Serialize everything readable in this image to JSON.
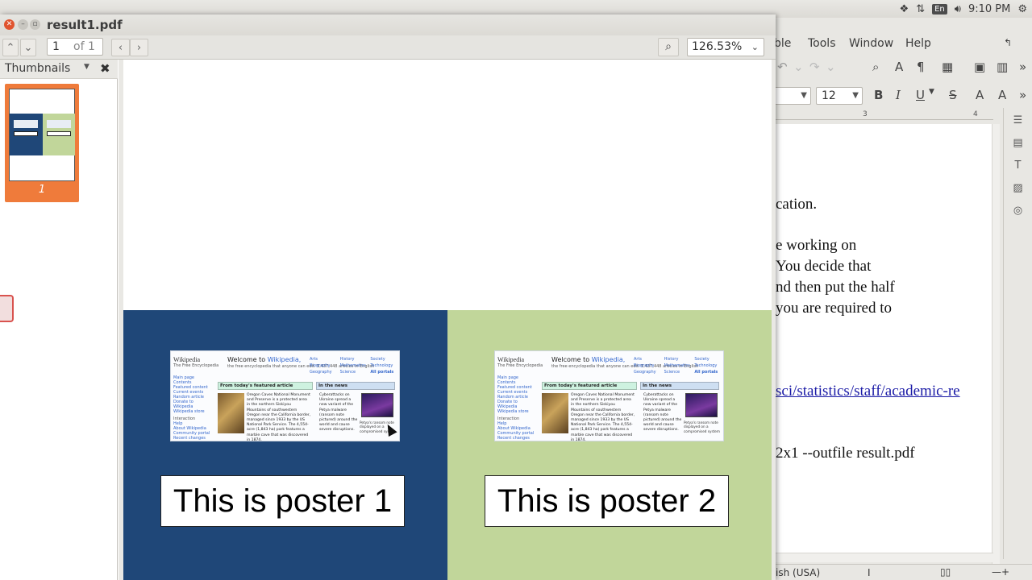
{
  "topbar": {
    "keyboard_layout": "En",
    "clock": "9:10 PM"
  },
  "writer": {
    "menu": [
      "ble",
      "Tools",
      "Window",
      "Help"
    ],
    "font_size": "12",
    "format_icons": {
      "bold": "B",
      "italic": "I",
      "underline": "U",
      "strike": "S"
    },
    "ruler_marks": [
      "3",
      "4"
    ],
    "doc_lines": [
      "cation.",
      "e working on",
      " You decide that",
      "nd then put the half",
      "you are required to"
    ],
    "doc_link": "sci/statistics/staff/academic-re",
    "doc_cmd": "2x1 --outfile result.pdf",
    "status_lang": "ish (USA)"
  },
  "viewer": {
    "title": "result1.pdf",
    "page_current": "1",
    "page_of": "of 1",
    "zoom": "126.53%",
    "sidebar_title": "Thumbnails",
    "thumb_page_label": "1"
  },
  "posters": [
    {
      "caption": "This is poster 1",
      "color": "#1f4778"
    },
    {
      "caption": "This is poster 2",
      "color": "#c1d69a"
    }
  ],
  "wiki": {
    "logo": "Wikipedia",
    "logo_sub": "The Free Encyclopedia",
    "welcome_prefix": "Welcome to ",
    "welcome_link": "Wikipedia,",
    "welcome_sub": "the free encyclopedia that anyone can edit. 5,437,448 articles in English",
    "nav": [
      "Main page",
      "Contents",
      "Featured content",
      "Current events",
      "Random article",
      "Donate to Wikipedia",
      "Wikipedia store",
      "Interaction",
      "Help",
      "About Wikipedia",
      "Community portal",
      "Recent changes"
    ],
    "portals": [
      "Arts",
      "Biography",
      "Geography",
      "History",
      "Mathematics",
      "Science",
      "Society",
      "Technology",
      "All portals"
    ],
    "featured_head": "From today's featured article",
    "featured_text": "Oregon Caves National Monument and Preserve is a protected area in the northern Siskiyou Mountains of southwestern Oregon near the California border, managed since 1933 by the US National Park Service. The 4,554-acre (1,843 ha) park features a marble cave that was discovered in 1874.",
    "news_head": "In the news",
    "news_text": "Cyberattacks on Ukraine spread a new variant of the Petya malware (ransom note pictured) around the world and cause severe disruptions.",
    "news_caption": "Petya's ransom note displayed on a compromised system"
  }
}
